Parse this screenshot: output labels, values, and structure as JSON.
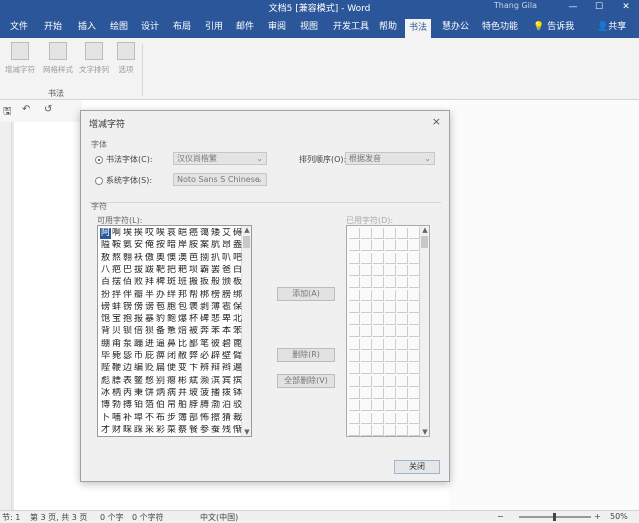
{
  "window": {
    "title": "文档5 [兼容模式] - Word",
    "user": "Thang Gila",
    "min_label": "—",
    "max_label": "☐",
    "close_label": "✕"
  },
  "tabs": [
    {
      "label": "文件",
      "active": false
    },
    {
      "label": "开始",
      "active": false
    },
    {
      "label": "插入",
      "active": false
    },
    {
      "label": "绘图",
      "active": false
    },
    {
      "label": "设计",
      "active": false
    },
    {
      "label": "布局",
      "active": false
    },
    {
      "label": "引用",
      "active": false
    },
    {
      "label": "邮件",
      "active": false
    },
    {
      "label": "审阅",
      "active": false
    },
    {
      "label": "视图",
      "active": false
    },
    {
      "label": "开发工具",
      "active": false
    },
    {
      "label": "帮助",
      "active": false
    },
    {
      "label": "书法",
      "active": true
    },
    {
      "label": "慧办公",
      "active": false
    },
    {
      "label": "特色功能",
      "active": false
    }
  ],
  "tell_me": "告诉我",
  "share": "共享",
  "ribbon": {
    "buttons": [
      "增减字符",
      "网格样式",
      "文字排列",
      "选项"
    ],
    "group_label": "书法"
  },
  "qat": {
    "save": "🖫",
    "undo": "↶",
    "redo": "↺"
  },
  "dialog": {
    "title": "增减字符",
    "close": "×",
    "font_section": "字体",
    "calligraphy_font_label": "书法字体(C):",
    "calligraphy_font_value": "汉仪尚楷繁",
    "system_font_label": "系统字体(S):",
    "system_font_value": "Noto Sans S Chinese",
    "sort_label": "排列顺序(O):",
    "sort_value": "根据发音",
    "char_section": "字符",
    "available_label": "可用字符(L):",
    "selected_label": "已用字符(D):",
    "add_button": "添加(A)",
    "remove_button": "删除(R)",
    "remove_all_button": "全部删除(V)",
    "close_button": "关闭",
    "characters": [
      "阿啊埃挨哎唉哀皑癌蔼矮艾碍爱",
      "隘鞍氨安俺按暗岸胺案肮昂盎凹",
      "敖熬翱袄傲奥懊澳芭捌扒叭吧笆",
      "八疤巴拔跋靶把耙坝霸罢爸白柏",
      "百摆佰败拜稗斑班搬扳般颁板版",
      "扮拌伴瓣半办绊邦帮梆榜膀绑棒",
      "磅蚌镑傍谤苞胞包褒剥薄雹保堡",
      "饱宝抱报暴豹鲍爆杯碑悲卑北辈",
      "背贝钡倍狈备惫焙被奔苯本笨崩",
      "绷甭泵蹦迸逼鼻比鄙笔彼碧蓖蔽",
      "毕毙毖币庇痹闭敝弊必辟壁臂避",
      "陛鞭边编贬扁便变卞辨辩辫遍标",
      "彪膘表鳖憋别瘪彬斌濒滨宾摈兵",
      "冰柄丙秉饼炳病并玻菠播拨钵波",
      "博勃搏铂箔伯帛舶脖膊渤泊驳捕",
      "卜哺补埠不布步簿部怖擦猜裁材",
      "才财睬踩采彩菜蔡餐参蚕残惭惨"
    ]
  },
  "status": {
    "section": "节: 1",
    "page": "第 3 页, 共 3 页",
    "words": "0 个字",
    "chars": "0 个字符",
    "language": "中文(中国)",
    "zoom": "50%"
  }
}
